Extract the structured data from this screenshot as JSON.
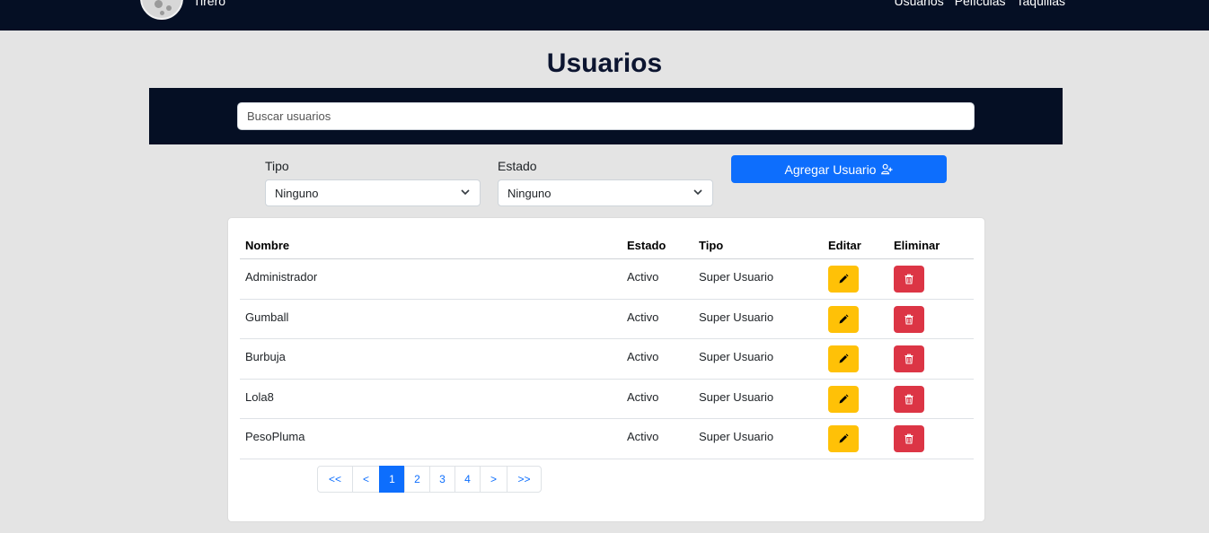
{
  "navbar": {
    "brand": "Tirero",
    "links": [
      "Usuarios",
      "Películas",
      "Taquillas"
    ]
  },
  "page": {
    "title": "Usuarios"
  },
  "search": {
    "placeholder": "Buscar usuarios"
  },
  "filters": {
    "tipo": {
      "label": "Tipo",
      "selected": "Ninguno"
    },
    "estado": {
      "label": "Estado",
      "selected": "Ninguno"
    }
  },
  "actions": {
    "add_user": "Agregar Usuario",
    "add_user_icon": "user-plus-icon"
  },
  "table": {
    "headers": {
      "nombre": "Nombre",
      "estado": "Estado",
      "tipo": "Tipo",
      "editar": "Editar",
      "eliminar": "Eliminar"
    },
    "rows": [
      {
        "nombre": "Administrador",
        "estado": "Activo",
        "tipo": "Super Usuario"
      },
      {
        "nombre": "Gumball",
        "estado": "Activo",
        "tipo": "Super Usuario"
      },
      {
        "nombre": "Burbuja",
        "estado": "Activo",
        "tipo": "Super Usuario"
      },
      {
        "nombre": "Lola8",
        "estado": "Activo",
        "tipo": "Super Usuario"
      },
      {
        "nombre": "PesoPluma",
        "estado": "Activo",
        "tipo": "Super Usuario"
      }
    ],
    "edit_icon": "pencil-icon",
    "delete_icon": "trash-icon"
  },
  "pagination": {
    "first": "<<",
    "prev": "<",
    "pages": [
      "1",
      "2",
      "3",
      "4"
    ],
    "current": "1",
    "next": ">",
    "last": ">>"
  },
  "colors": {
    "navbar": "#050f24",
    "primary": "#0d6efd",
    "warning": "#ffc107",
    "danger": "#dc3545",
    "background": "#e4e4e4"
  }
}
